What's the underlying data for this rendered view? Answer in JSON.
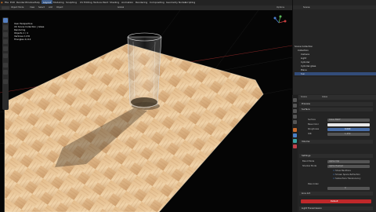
{
  "topbar": {
    "menus": [
      "File",
      "Edit",
      "Render",
      "Window",
      "Help"
    ],
    "workspaces": [
      "Layout",
      "Modeling",
      "Sculpting",
      "UV Editing",
      "Texture Paint",
      "Shading",
      "Animation",
      "Rendering",
      "Compositing",
      "Geometry Nodes",
      "Scripting"
    ],
    "scene": "Scene",
    "view_layer": "ViewLayer"
  },
  "toolbar2": {
    "mode": "Object Mode",
    "items": [
      "View",
      "Select",
      "Add",
      "Object"
    ],
    "transform": "Global",
    "options": "Options"
  },
  "viewport": {
    "overlay_lines": [
      "User Perspective",
      "(0) Scene Collection | Glass",
      "Rendering",
      "Objects 1 / 4",
      "Vertices",
      "Triangles"
    ],
    "overlay_values": [
      "",
      "",
      "",
      "",
      "2,176",
      "4,112"
    ]
  },
  "outliner": {
    "header": "Scene",
    "rows": [
      "Scene Collection",
      "Collection",
      "Camera",
      "Light",
      "Cylinder",
      "Cylinder.glass",
      "Plane",
      "Sun"
    ]
  },
  "properties": {
    "object_name": "Scene",
    "material": "Glass",
    "sections": [
      "Preview",
      "Surface",
      "Volume",
      "Settings",
      "Line Art",
      "Light Transmission"
    ],
    "surface_labels": [
      "Surface",
      "Base Color",
      "Roughness",
      "IOR"
    ],
    "surface_values": [
      "Glass BSDF",
      "",
      "0.000",
      "1.450"
    ],
    "settings_labels": [
      "Blend Mode",
      "Shadow Mode",
      "Show Backface",
      "Refraction Depth",
      "Screen Space Refraction",
      "Subsurface Translucency",
      "Pass Index"
    ],
    "settings_values": [
      "Alpha Clip",
      "Alpha Hashed",
      "",
      "0 m",
      "",
      "",
      "0"
    ],
    "button": "Default"
  },
  "colors": {
    "accent": "#5680c2",
    "active_button": "#d22c2c",
    "floor_light": "#e7c596",
    "floor_dark": "#c29669"
  }
}
